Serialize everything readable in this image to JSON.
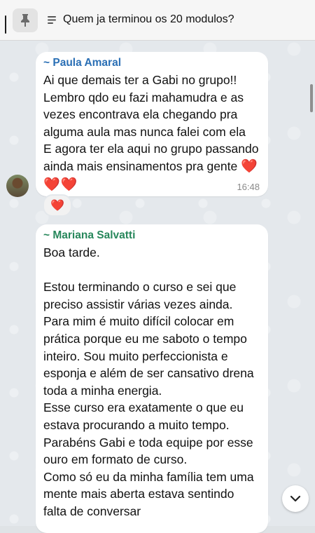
{
  "pinned": {
    "title": "Quem ja terminou os 20 modulos?",
    "pin_icon": "pin-icon",
    "text_icon": "text-lines-icon"
  },
  "messages": [
    {
      "sender": "~ Paula Amaral",
      "sender_color": "#2a6fb5",
      "text": "Ai que demais ter a Gabi no grupo!!\nLembro qdo eu fazi mahamudra e as vezes encontrava ela chegando pra alguma aula mas nunca falei com ela\nE agora ter ela aqui no grupo passando ainda mais ensinamentos pra gente",
      "hearts": "❤️❤️❤️",
      "time": "16:48",
      "reaction": "❤️"
    },
    {
      "sender": "~ Mariana Salvatti",
      "sender_color": "#27875b",
      "text": "Boa tarde.\n\nEstou terminando o curso e sei que preciso assistir várias vezes ainda. Para mim é muito difícil colocar em prática porque eu me saboto o tempo inteiro. Sou muito perfeccionista e esponja e além de ser cansativo drena toda a minha energia.\nEsse curso era exatamente o que eu estava procurando a muito tempo. Parabéns Gabi e toda equipe por esse ouro em formato de curso.\nComo só eu da minha família tem uma mente mais aberta estava sentindo falta de conversar"
    }
  ],
  "controls": {
    "scroll_down_icon": "chevron-down-icon"
  }
}
